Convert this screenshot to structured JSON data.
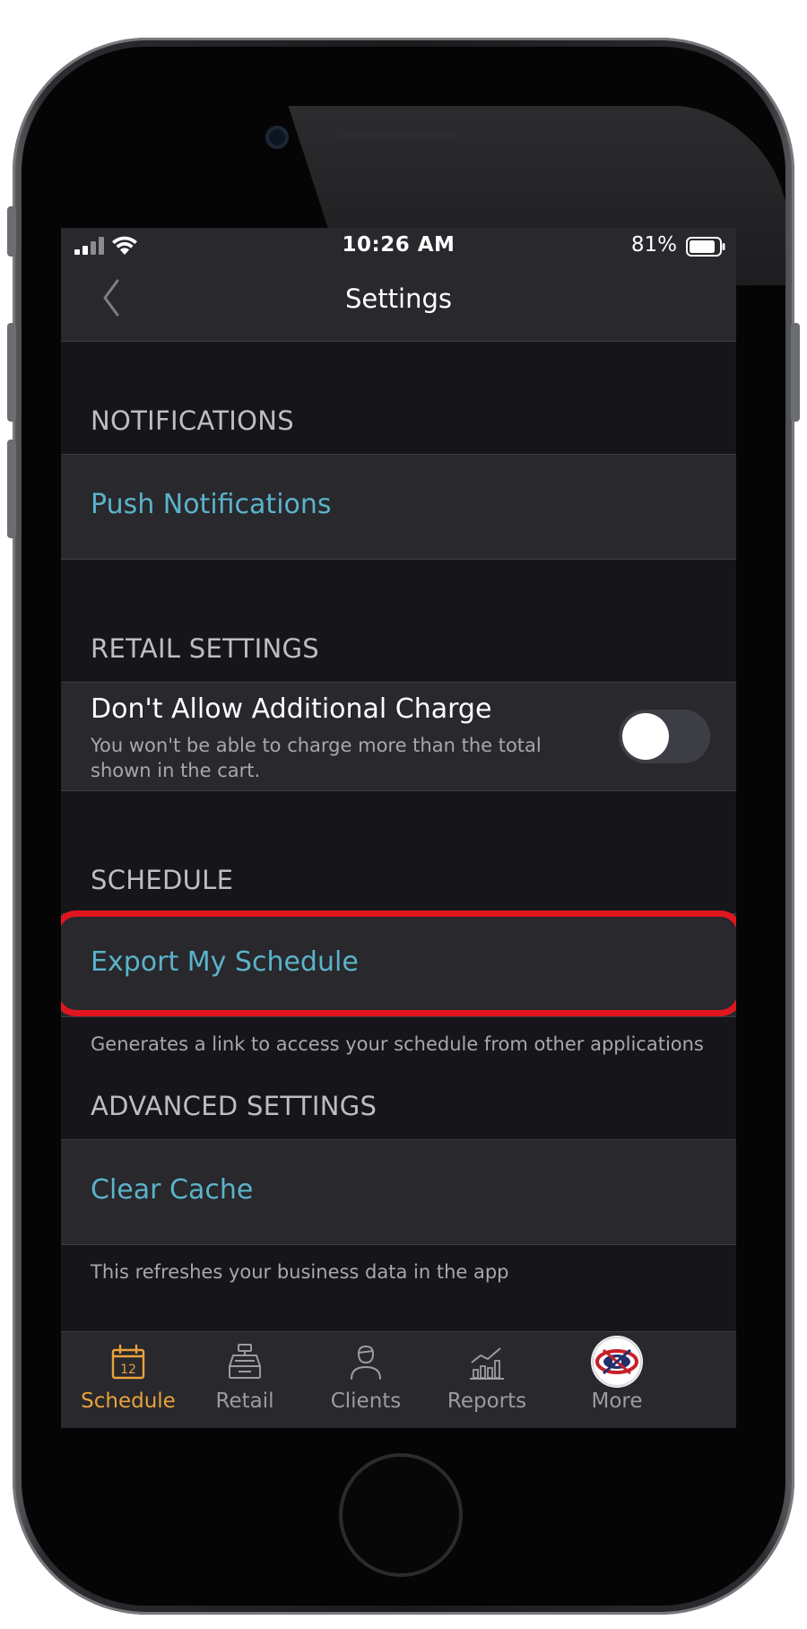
{
  "status_bar": {
    "time": "10:26 AM",
    "battery_percent": "81%"
  },
  "nav": {
    "title": "Settings"
  },
  "sections": {
    "notifications": {
      "header": "NOTIFICATIONS",
      "push_label": "Push Notifications"
    },
    "retail": {
      "header": "RETAIL SETTINGS",
      "setting_title": "Don't Allow Additional Charge",
      "setting_desc": "You won't be able to charge more than the total shown in the cart.",
      "toggle_on": false
    },
    "schedule": {
      "header": "SCHEDULE",
      "export_label": "Export My Schedule",
      "footnote": "Generates a link to access your schedule from other applications"
    },
    "advanced": {
      "header": "ADVANCED SETTINGS",
      "clear_label": "Clear Cache",
      "footnote": "This refreshes your business data in the app"
    }
  },
  "tabs": [
    {
      "label": "Schedule",
      "icon": "calendar-icon",
      "badge": "12",
      "active": true
    },
    {
      "label": "Retail",
      "icon": "cash-register-icon",
      "active": false
    },
    {
      "label": "Clients",
      "icon": "person-icon",
      "active": false
    },
    {
      "label": "Reports",
      "icon": "bar-chart-icon",
      "active": false
    },
    {
      "label": "More",
      "icon": "avatar-icon",
      "active": false
    }
  ],
  "colors": {
    "accent_link": "#5bb3c9",
    "active_tab": "#e9a23b",
    "highlight": "#e0161e",
    "background": "#16161a",
    "cell": "#28282d"
  }
}
